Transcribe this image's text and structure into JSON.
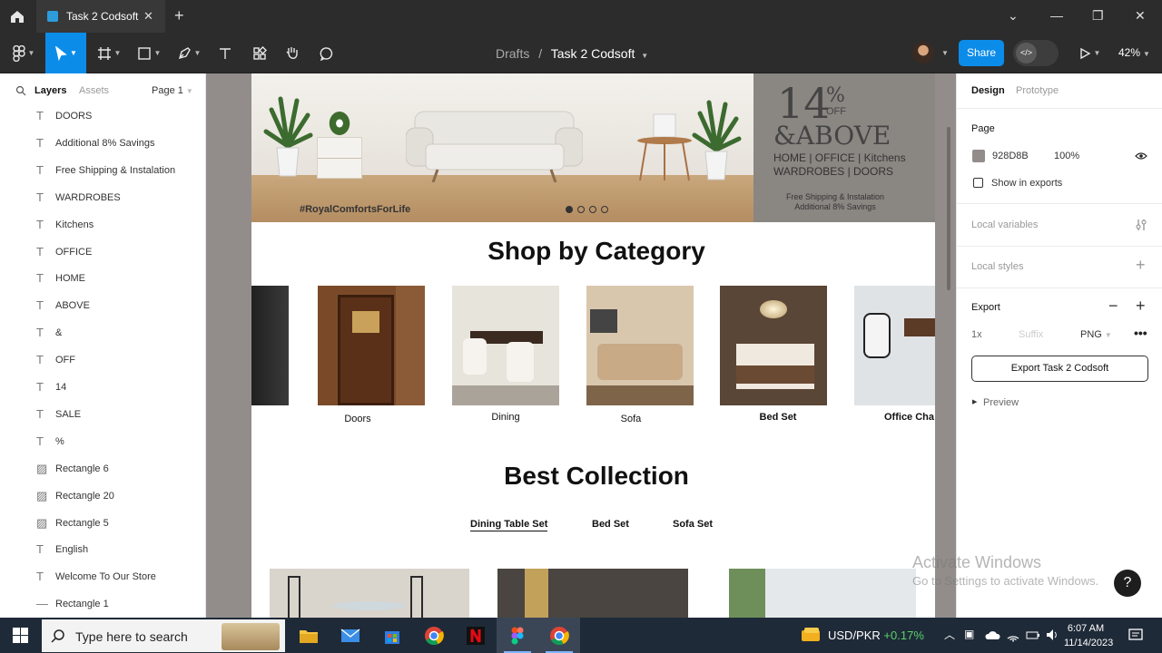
{
  "window": {
    "tab_title": "Task 2 Codsoft"
  },
  "toolbar": {
    "breadcrumb_parent": "Drafts",
    "breadcrumb_separator": "/",
    "file_name": "Task 2 Codsoft",
    "share_label": "Share",
    "zoom": "42%"
  },
  "left_panel": {
    "tabs": [
      "Layers",
      "Assets"
    ],
    "page_selector": "Page 1",
    "layers": [
      {
        "type": "text",
        "name": "DOORS"
      },
      {
        "type": "text",
        "name": "Additional 8% Savings"
      },
      {
        "type": "text",
        "name": "Free Shipping & Instalation"
      },
      {
        "type": "text",
        "name": "WARDROBES"
      },
      {
        "type": "text",
        "name": "Kitchens"
      },
      {
        "type": "text",
        "name": "OFFICE"
      },
      {
        "type": "text",
        "name": "HOME"
      },
      {
        "type": "text",
        "name": "ABOVE"
      },
      {
        "type": "text",
        "name": "&"
      },
      {
        "type": "text",
        "name": "OFF"
      },
      {
        "type": "text",
        "name": "14"
      },
      {
        "type": "text",
        "name": "SALE"
      },
      {
        "type": "text",
        "name": "%"
      },
      {
        "type": "image",
        "name": "Rectangle 6"
      },
      {
        "type": "image",
        "name": "Rectangle 20"
      },
      {
        "type": "image",
        "name": "Rectangle 5"
      },
      {
        "type": "text",
        "name": "English"
      },
      {
        "type": "text",
        "name": "Welcome To Our Store"
      },
      {
        "type": "rect",
        "name": "Rectangle 1"
      }
    ]
  },
  "design_canvas": {
    "hero": {
      "hashtag": "#RoyalComfortsForLife",
      "promo_number": "14",
      "promo_percent": "%",
      "promo_off": "OFF",
      "promo_above": "&ABOVE",
      "promo_line1": "HOME | OFFICE | Kitchens",
      "promo_line2": "WARDROBES | DOORS",
      "promo_small1": "Free Shipping & Instalation",
      "promo_small2": "Additional 8% Savings",
      "carousel_dots": 4
    },
    "shop_title": "Shop by Category",
    "categories": [
      "Doors",
      "Dining",
      "Sofa",
      "Bed Set",
      "Office Cha"
    ],
    "best_title": "Best Collection",
    "collection_tabs": [
      "Dining Table Set",
      "Bed Set",
      "Sofa Set"
    ],
    "active_tab": "Dining Table Set"
  },
  "right_panel": {
    "tabs": [
      "Design",
      "Prototype"
    ],
    "page_section": "Page",
    "page_color": "928D8B",
    "page_opacity": "100%",
    "show_in_exports": "Show in exports",
    "local_variables": "Local variables",
    "local_styles": "Local styles",
    "export_section": "Export",
    "export_scale": "1x",
    "export_suffix_placeholder": "Suffix",
    "export_format": "PNG",
    "export_button": "Export Task 2 Codsoft",
    "preview": "Preview"
  },
  "watermark": {
    "line1": "Activate Windows",
    "line2": "Go to Settings to activate Windows."
  },
  "taskbar": {
    "search_placeholder": "Type here to search",
    "ticker_pair": "USD/PKR",
    "ticker_change": "+0.17%",
    "time": "6:07 AM",
    "date": "11/14/2023"
  },
  "colors": {
    "accent": "#0c8ce9",
    "canvas_bg": "#928d8b",
    "ticker_positive": "#58d36a"
  }
}
